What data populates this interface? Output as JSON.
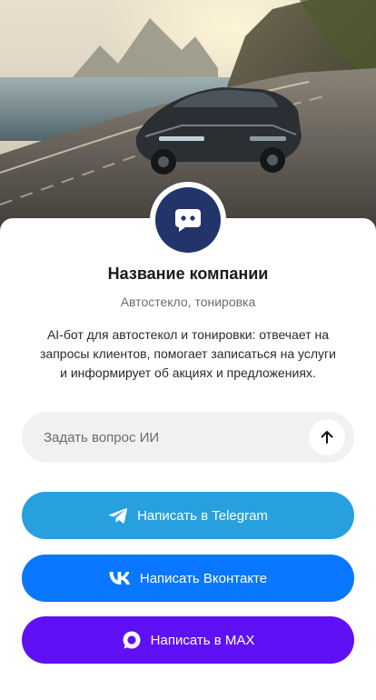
{
  "company": {
    "name": "Название компании",
    "category": "Автостекло, тонировка",
    "description": "AI-бот для автостекол и тонировки: отвечает на запросы клиентов, помогает записаться на услуги и информирует об акциях и предложениях."
  },
  "ask": {
    "placeholder": "Задать вопрос ИИ",
    "send_icon": "arrow-up-icon"
  },
  "buttons": {
    "telegram": {
      "label": "Написать в Telegram",
      "icon": "telegram-icon",
      "color": "#28a0df"
    },
    "vk": {
      "label": "Написать Вконтакте",
      "icon": "vk-icon",
      "color": "#0977ff"
    },
    "max": {
      "label": "Написать в MAX",
      "icon": "max-icon",
      "color": "#6010f5"
    }
  },
  "avatar": {
    "icon": "chat-bot-icon",
    "color": "#22346a"
  }
}
